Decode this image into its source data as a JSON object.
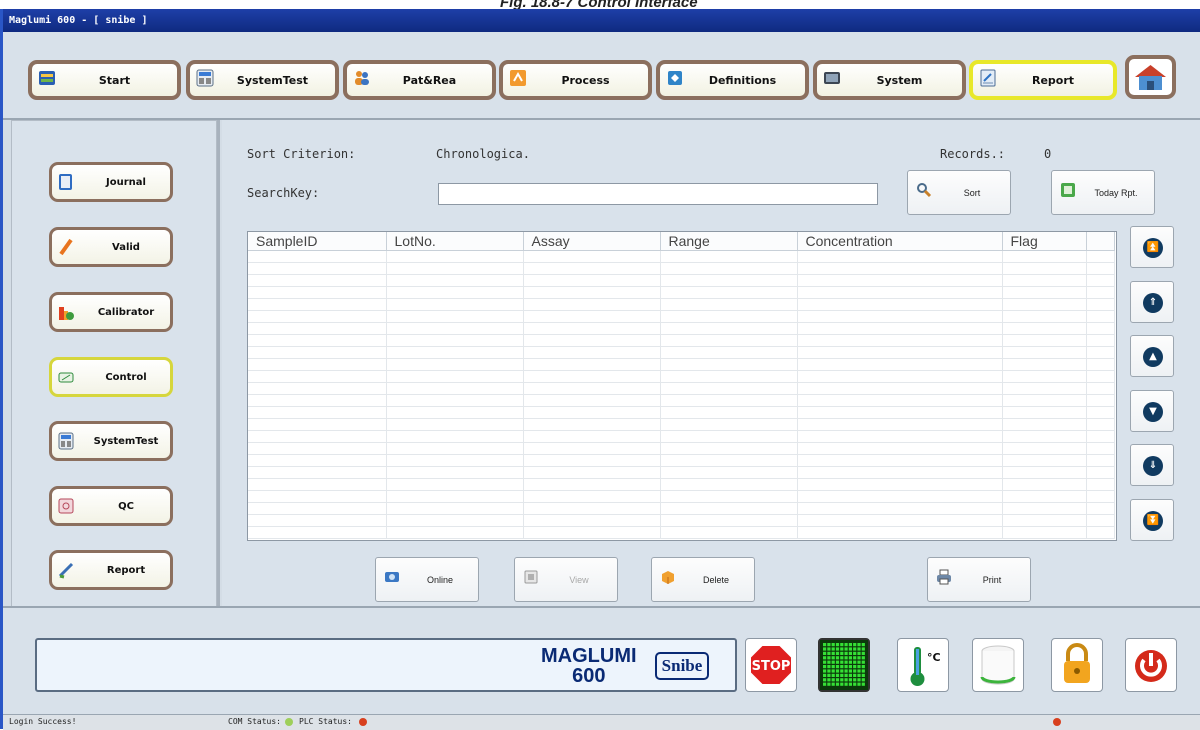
{
  "caption": "Fig. 18.8-7 Control Interface",
  "window_title": "Maglumi 600 - [ snibe ]",
  "topnav": [
    {
      "label": "Start",
      "icon": "start-icon"
    },
    {
      "label": "SystemTest",
      "icon": "systemtest-icon"
    },
    {
      "label": "Pat&Rea",
      "icon": "patients-icon"
    },
    {
      "label": "Process",
      "icon": "process-icon"
    },
    {
      "label": "Definitions",
      "icon": "definitions-icon"
    },
    {
      "label": "System",
      "icon": "system-icon"
    },
    {
      "label": "Report",
      "icon": "report-icon",
      "active": true
    }
  ],
  "sidebar": [
    {
      "label": "Journal",
      "icon": "journal-icon"
    },
    {
      "label": "Valid",
      "icon": "valid-icon"
    },
    {
      "label": "Calibrator",
      "icon": "calibrator-icon"
    },
    {
      "label": "Control",
      "icon": "control-icon",
      "active": true
    },
    {
      "label": "SystemTest",
      "icon": "systemtest-icon"
    },
    {
      "label": "QC",
      "icon": "qc-icon"
    },
    {
      "label": "Report",
      "icon": "report-icon"
    }
  ],
  "main": {
    "sort_criterion_label": "Sort Criterion:",
    "sort_criterion_value": "Chronologica.",
    "records_label": "Records.:",
    "records_value": "0",
    "searchkey_label": "SearchKey:",
    "searchkey_value": "",
    "sort_button": "Sort",
    "today_button": "Today Rpt.",
    "columns": [
      "SampleID",
      "LotNo.",
      "Assay",
      "Range",
      "Concentration",
      "Flag"
    ],
    "rows": [],
    "buttons": {
      "online": "Online",
      "view": "View",
      "delete": "Delete",
      "print": "Print"
    }
  },
  "brand": {
    "name": "MAGLUMI",
    "model": "600",
    "logo": "Snibe"
  },
  "statusbar": {
    "message": "Login Success!",
    "com_label": "COM Status:",
    "plc_label": "PLC Status:"
  },
  "colors": {
    "active_border": "#e8e82a",
    "button_border": "#8b6f5e",
    "title_bar": "#1e3fa8",
    "arrow_circle": "#103a60"
  }
}
